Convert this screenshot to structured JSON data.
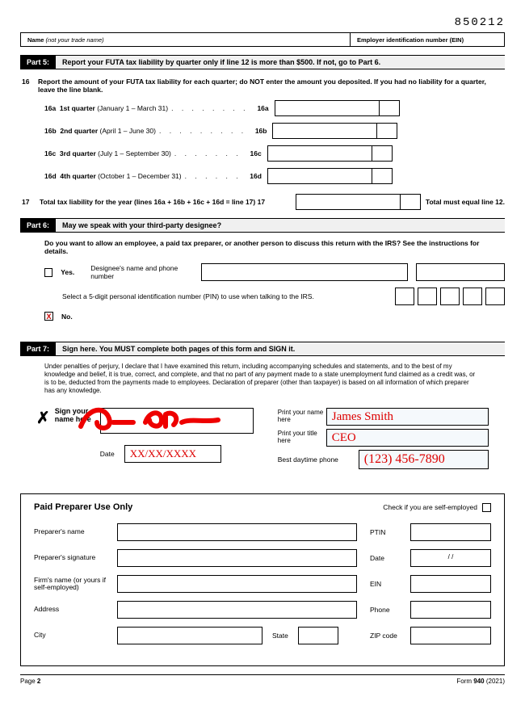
{
  "form_id": "850212",
  "header": {
    "name_label_bold": "Name",
    "name_label_italic": " (not your trade name)",
    "ein_label": "Employer identification number (EIN)"
  },
  "part5": {
    "label": "Part 5:",
    "title": "Report your FUTA tax liability by quarter only if line 12 is more than $500. If not, go to Part 6."
  },
  "line16": {
    "num": "16",
    "intro": "Report the amount of your FUTA tax liability for each quarter; do NOT enter the amount you deposited. If you had no liability for a quarter, leave the line blank.",
    "a": {
      "code": "16a",
      "bold": "1st quarter",
      "rest": " (January 1 – March 31)",
      "dots": ".   .   .   .   .   .   .   .",
      "box": "16a"
    },
    "b": {
      "code": "16b",
      "bold": "2nd quarter",
      "rest": " (April 1 – June 30)",
      "dots": ".   .   .   .   .   .   .   .   .",
      "box": "16b"
    },
    "c": {
      "code": "16c",
      "bold": "3rd quarter",
      "rest": " (July 1 – September 30)",
      "dots": ".   .   .   .   .   .   .",
      "box": "16c"
    },
    "d": {
      "code": "16d",
      "bold": "4th quarter",
      "rest": " (October 1 – December 31)",
      "dots": ".   .   .   .   .   .",
      "box": "16d"
    }
  },
  "line17": {
    "num": "17",
    "text": "Total tax liability for the year (lines 16a + 16b + 16c + 16d = line 17)",
    "box": "17",
    "note": "Total must equal line 12."
  },
  "part6": {
    "label": "Part 6:",
    "title": "May we speak with your third-party designee?",
    "question": "Do you want to allow an employee, a paid tax preparer, or another person to discuss this return with the IRS? See the instructions for details.",
    "yes": "Yes.",
    "designee": "Designee's name and phone number",
    "pin_text": "Select a 5-digit personal identification number (PIN) to use when talking to the IRS.",
    "no": "No.",
    "no_checked": "X"
  },
  "part7": {
    "label": "Part 7:",
    "title": "Sign here. You MUST complete both pages of this form and SIGN it.",
    "perjury": "Under penalties of perjury, I declare that I have examined this return, including accompanying schedules and statements, and to the best of my knowledge and belief, it is true, correct, and complete, and that no part of any payment made to a state unemployment fund claimed as a credit was, or is to be, deducted from the payments made to employees. Declaration of preparer (other than taxpayer) is based on all information of which preparer has any knowledge."
  },
  "sign": {
    "x": "✗",
    "sign_label": "Sign your name here",
    "print_name_label": "Print your name here",
    "print_name_value": "James Smith",
    "print_title_label": "Print your title here",
    "print_title_value": "CEO",
    "date_label": "Date",
    "date_value": "XX/XX/XXXX",
    "phone_label": "Best daytime phone",
    "phone_value": "(123) 456-7890"
  },
  "preparer": {
    "heading": "Paid Preparer Use Only",
    "self_emp": "Check if you are self-employed",
    "name": "Preparer's name",
    "sig": "Preparer's signature",
    "firm": "Firm's name (or yours if self-employed)",
    "address": "Address",
    "city": "City",
    "state": "State",
    "ptin": "PTIN",
    "date": "Date",
    "date_val": "/       /",
    "ein": "EIN",
    "phone": "Phone",
    "zip": "ZIP code"
  },
  "footer": {
    "page": "Page ",
    "page_num": "2",
    "form": "Form ",
    "form_num": "940",
    "year": " (2021)"
  }
}
